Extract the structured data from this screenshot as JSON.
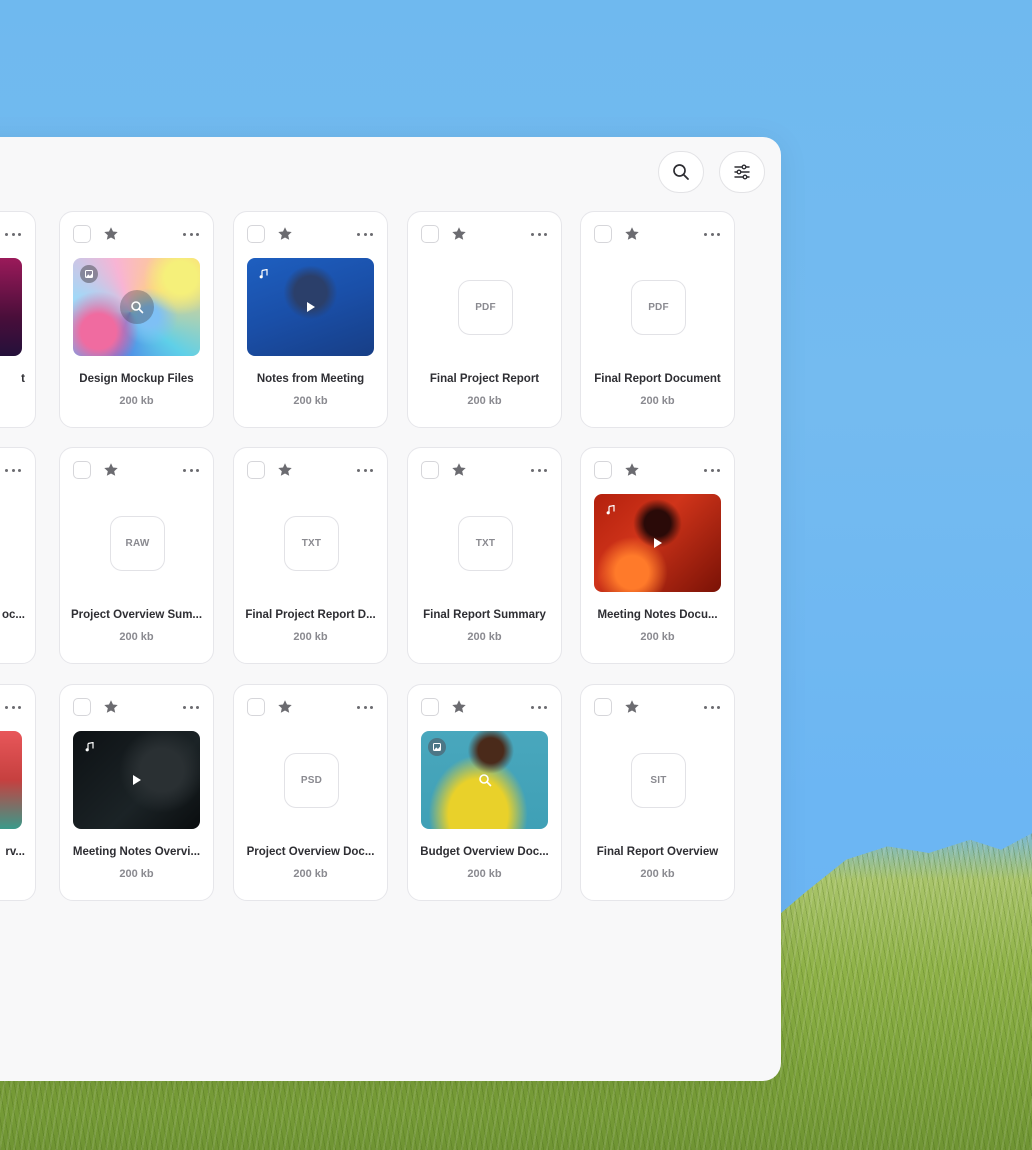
{
  "toolbar": {
    "search_icon": "search-icon",
    "filter_icon": "sliders-icon"
  },
  "rows": [
    [
      {
        "name": "t",
        "size": "",
        "kind": "image-partial"
      },
      {
        "name": "Design Mockup Files",
        "size": "200 kb",
        "kind": "image",
        "badge": "image",
        "overlay": "search"
      },
      {
        "name": "Notes from Meeting",
        "size": "200 kb",
        "kind": "video",
        "badge": "music",
        "overlay": "play"
      },
      {
        "name": "Final Project Report",
        "size": "200 kb",
        "kind": "file",
        "ext": "PDF"
      },
      {
        "name": "Final Report Document",
        "size": "200 kb",
        "kind": "file",
        "ext": "PDF"
      }
    ],
    [
      {
        "name": "oc...",
        "size": "",
        "kind": "file-partial"
      },
      {
        "name": "Project Overview Sum...",
        "size": "200 kb",
        "kind": "file",
        "ext": "RAW"
      },
      {
        "name": "Final Project Report D...",
        "size": "200 kb",
        "kind": "file",
        "ext": "TXT"
      },
      {
        "name": "Final Report Summary",
        "size": "200 kb",
        "kind": "file",
        "ext": "TXT"
      },
      {
        "name": "Meeting Notes Docu...",
        "size": "200 kb",
        "kind": "video",
        "badge": "music",
        "overlay": "play"
      }
    ],
    [
      {
        "name": "rv...",
        "size": "",
        "kind": "image-partial"
      },
      {
        "name": "Meeting Notes Overvi...",
        "size": "200 kb",
        "kind": "video",
        "badge": "music",
        "overlay": "play"
      },
      {
        "name": "Project Overview Doc...",
        "size": "200 kb",
        "kind": "file",
        "ext": "PSD"
      },
      {
        "name": "Budget Overview Doc...",
        "size": "200 kb",
        "kind": "image",
        "badge": "image",
        "overlay": "search"
      },
      {
        "name": "Final Report Overview",
        "size": "200 kb",
        "kind": "file",
        "ext": "SIT"
      }
    ]
  ]
}
